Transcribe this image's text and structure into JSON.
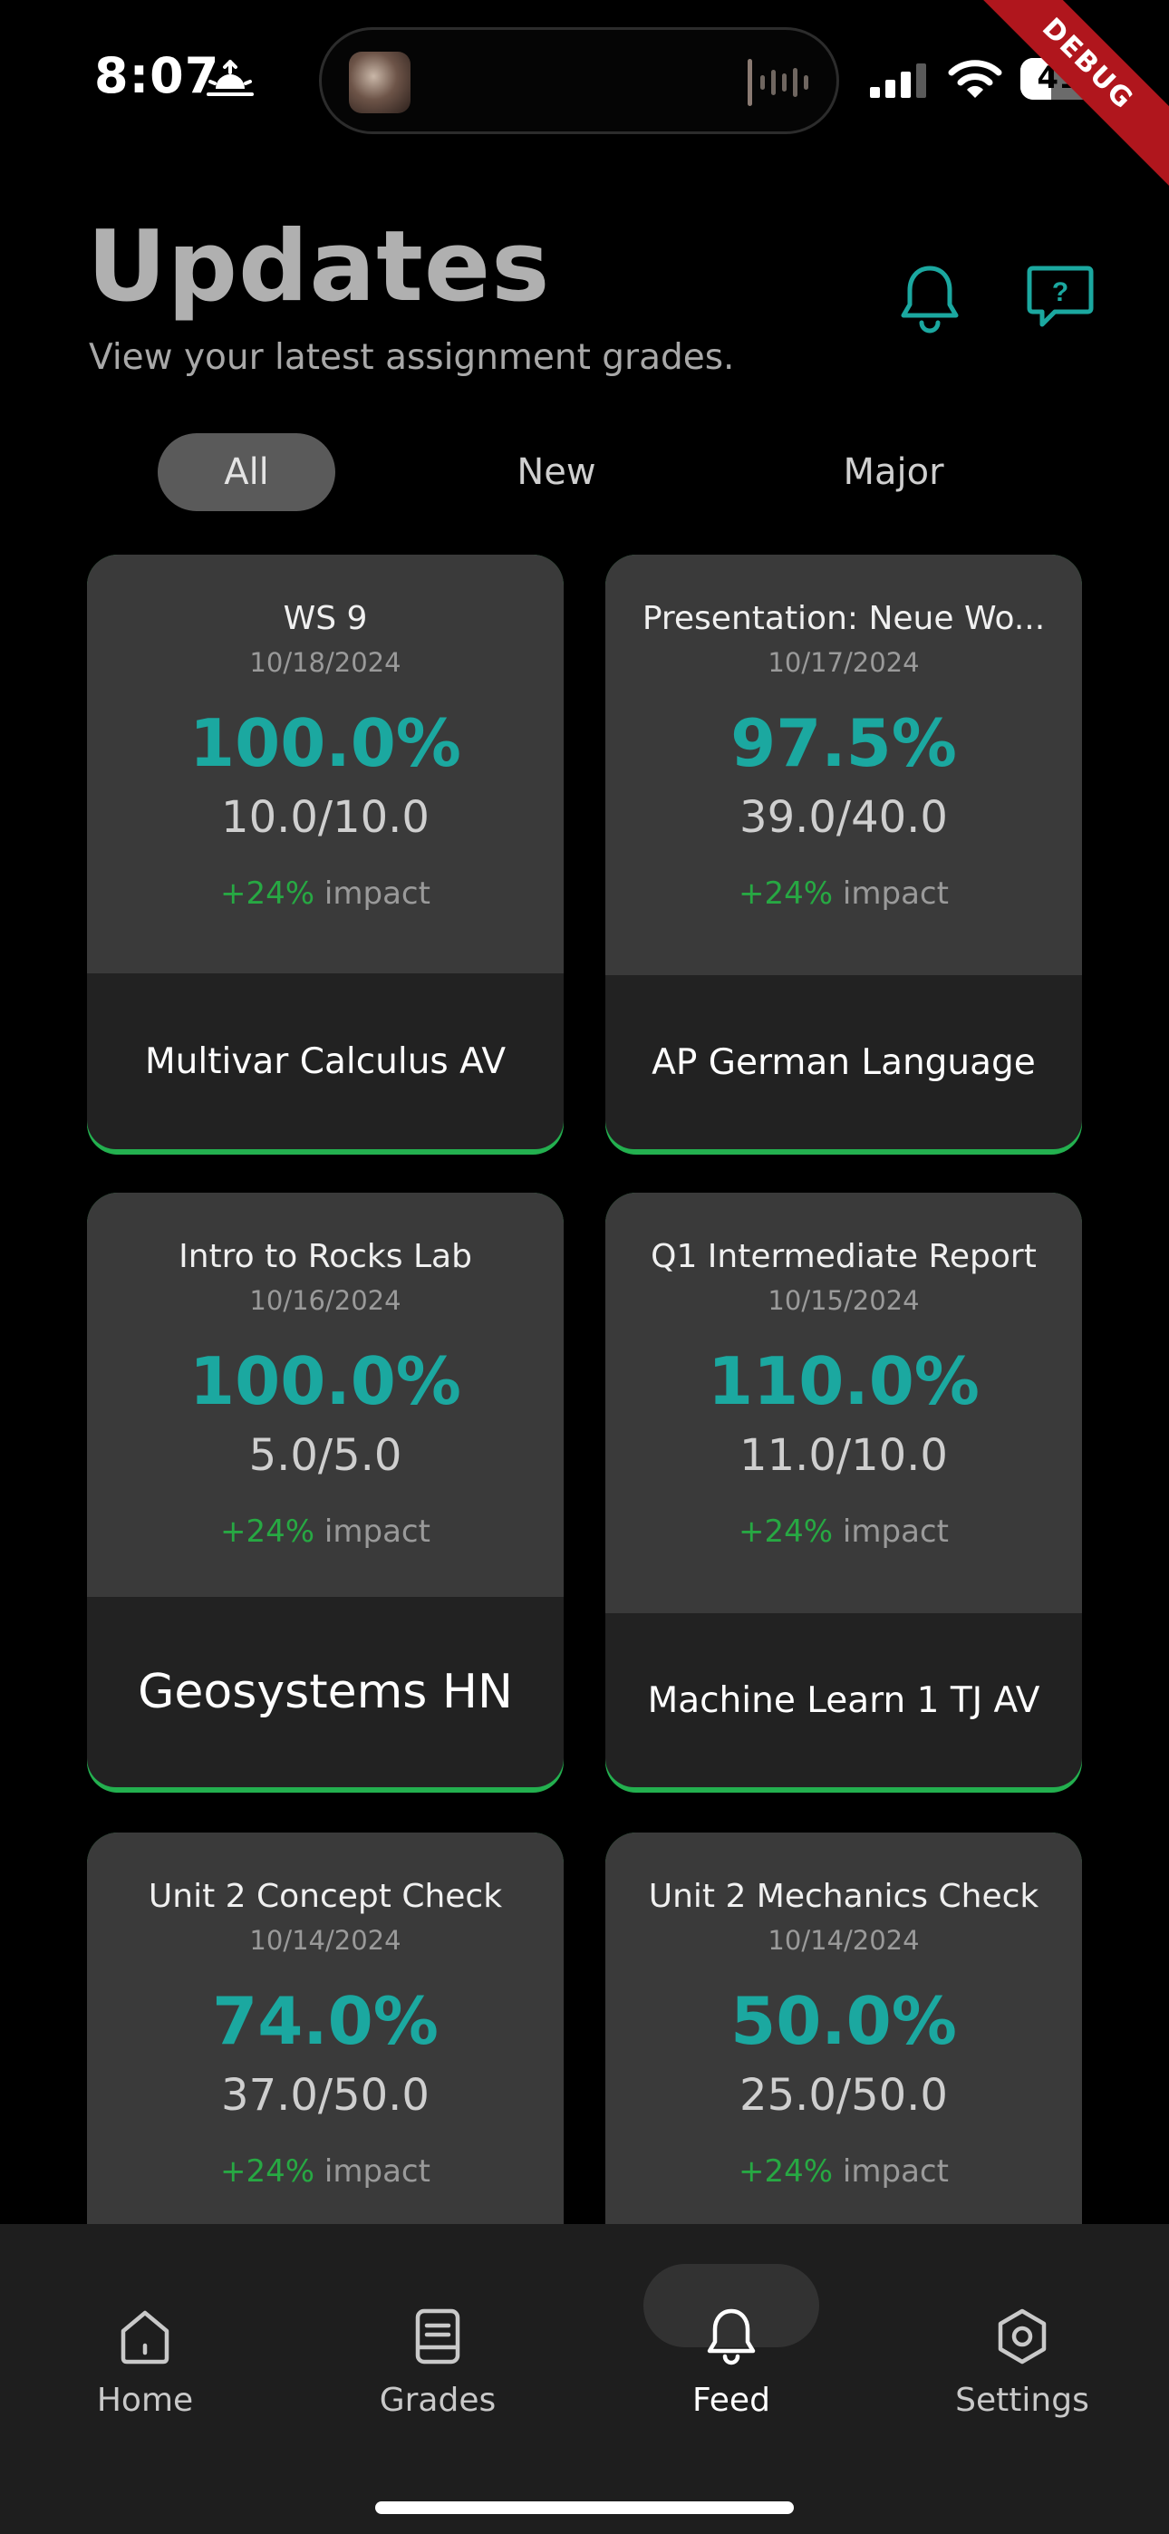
{
  "status_bar": {
    "time": "8:07",
    "battery": "41",
    "battery_level": 0.41,
    "debug_label": "DEBUG",
    "icons": [
      "sunrise-icon",
      "cellular-signal-icon",
      "wifi-icon",
      "battery-icon"
    ]
  },
  "header": {
    "title": "Updates",
    "subtitle": "View your latest assignment grades.",
    "icons": [
      "bell-icon",
      "help-chat-icon"
    ],
    "accent": "#1ba8a0"
  },
  "filters": {
    "tabs": [
      {
        "label": "All",
        "active": true
      },
      {
        "label": "New",
        "active": false
      },
      {
        "label": "Major",
        "active": false
      }
    ]
  },
  "cards": [
    {
      "title": "WS 9",
      "date": "10/18/2024",
      "percent": "100.0%",
      "score": "10.0/10.0",
      "impact_value": "+24%",
      "impact_word": "impact",
      "course": "Multivar Calculus AV"
    },
    {
      "title": "Presentation: Neue Wo...",
      "date": "10/17/2024",
      "percent": "97.5%",
      "score": "39.0/40.0",
      "impact_value": "+24%",
      "impact_word": "impact",
      "course": "AP German Language"
    },
    {
      "title": "Intro to Rocks Lab",
      "date": "10/16/2024",
      "percent": "100.0%",
      "score": "5.0/5.0",
      "impact_value": "+24%",
      "impact_word": "impact",
      "course": "Geosystems HN"
    },
    {
      "title": "Q1 Intermediate Report",
      "date": "10/15/2024",
      "percent": "110.0%",
      "score": "11.0/10.0",
      "impact_value": "+24%",
      "impact_word": "impact",
      "course": "Machine Learn 1 TJ AV"
    },
    {
      "title": "Unit 2 Concept Check",
      "date": "10/14/2024",
      "percent": "74.0%",
      "score": "37.0/50.0",
      "impact_value": "+24%",
      "impact_word": "impact",
      "course": ""
    },
    {
      "title": "Unit 2 Mechanics Check",
      "date": "10/14/2024",
      "percent": "50.0%",
      "score": "25.0/50.0",
      "impact_value": "+24%",
      "impact_word": "impact",
      "course": ""
    }
  ],
  "nav": {
    "items": [
      {
        "label": "Home",
        "icon": "home-icon",
        "active": false
      },
      {
        "label": "Grades",
        "icon": "grades-book-icon",
        "active": false
      },
      {
        "label": "Feed",
        "icon": "bell-icon",
        "active": true
      },
      {
        "label": "Settings",
        "icon": "settings-gear-icon",
        "active": false
      }
    ]
  },
  "colors": {
    "background": "#000000",
    "card": "#3a3a3a",
    "card_footer": "#222222",
    "percent": "#1ba8a0",
    "impact": "#27a843",
    "card_glow": "#23b04f",
    "nav_bar": "#1e1e1e"
  }
}
